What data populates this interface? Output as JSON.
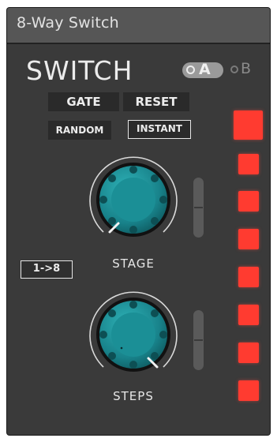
{
  "window": {
    "title": "8-Way Switch"
  },
  "brand": {
    "name": "SWITCH"
  },
  "mode_toggle": {
    "option_a": "A",
    "option_b": "B",
    "selected": "A"
  },
  "buttons": {
    "gate": "GATE",
    "reset": "RESET",
    "random": "RANDOM",
    "instant": "INSTANT"
  },
  "range_label": "1->8",
  "knobs": {
    "stage": {
      "label": "STAGE"
    },
    "steps": {
      "label": "STEPS"
    }
  },
  "leds": {
    "count": 8,
    "active_index": 0,
    "color": "#ff3b30"
  },
  "colors": {
    "panel": "#3a3a3a",
    "titlebar": "#565656",
    "knob": "#1f8c92",
    "led": "#ff3b30"
  }
}
